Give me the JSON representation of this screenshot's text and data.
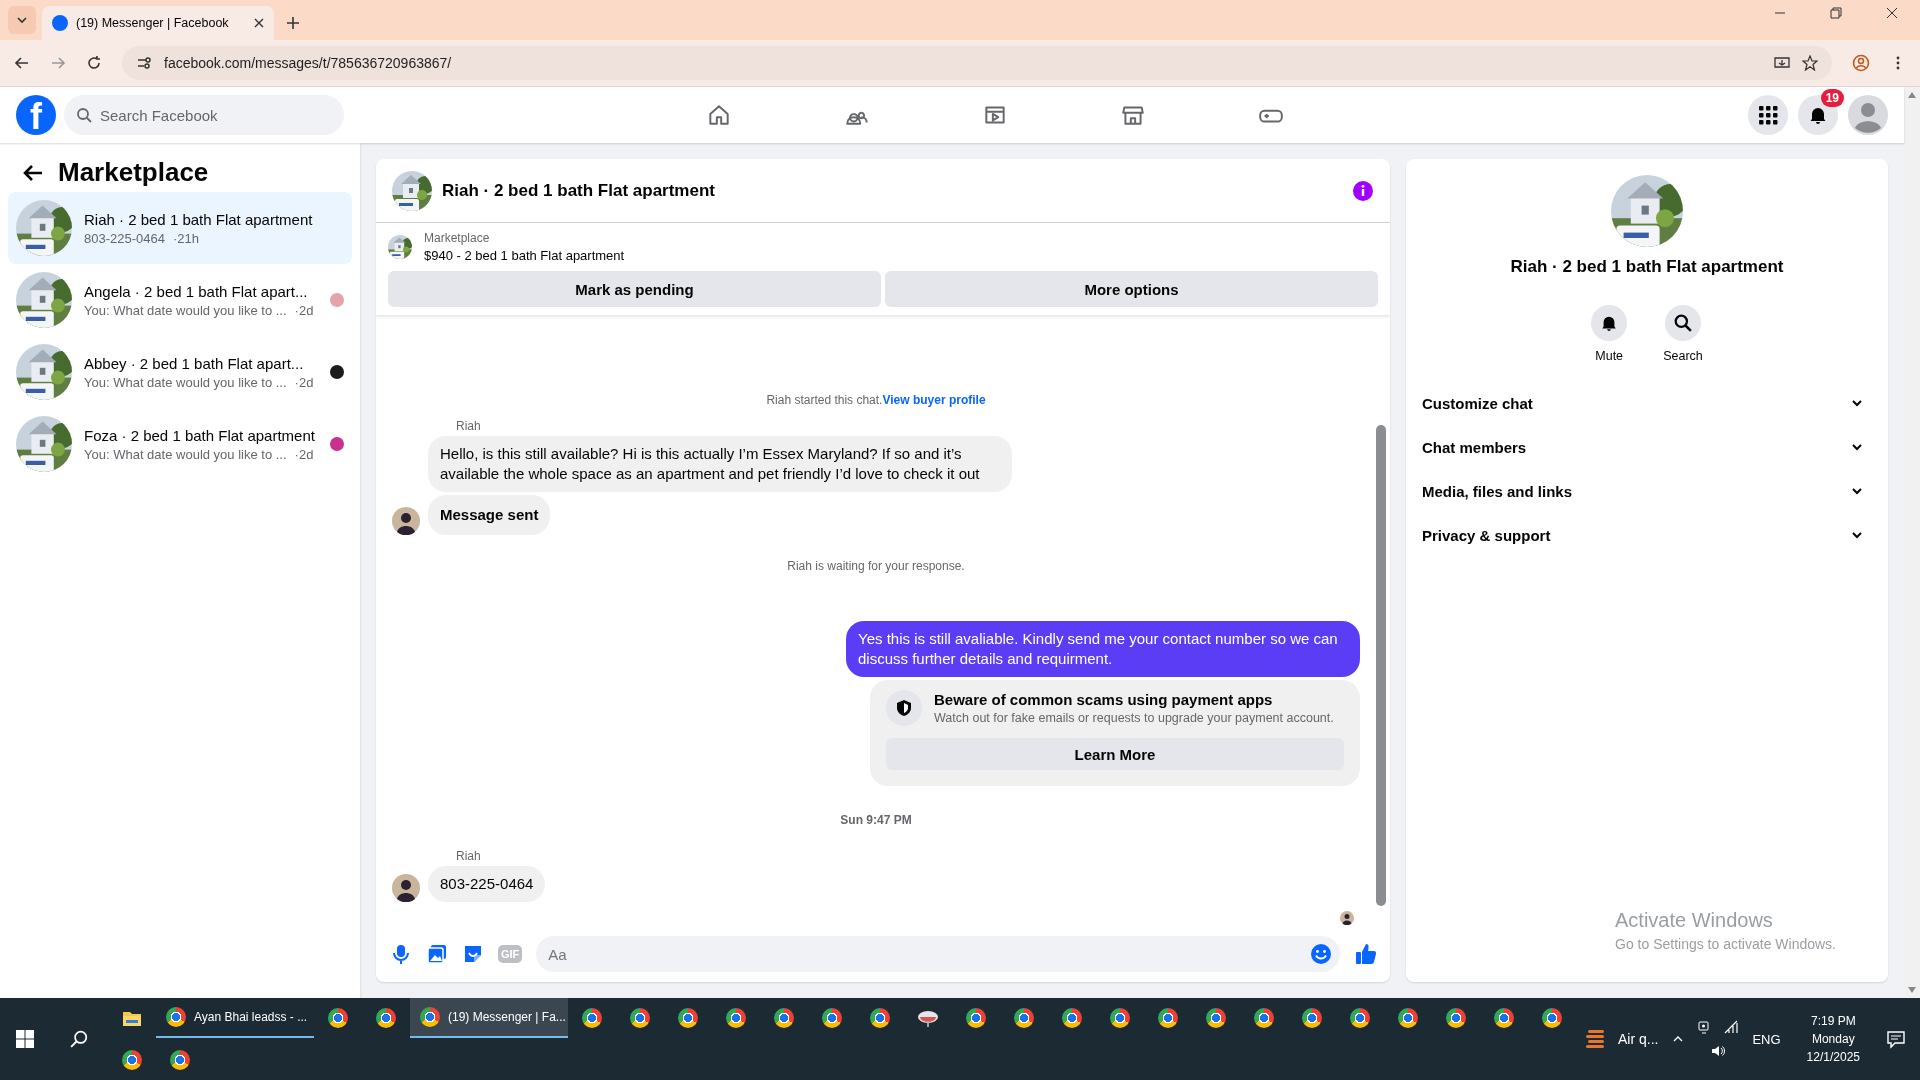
{
  "browser": {
    "tabs": [
      {
        "title": "(19) Messenger | Facebook",
        "selected": true
      }
    ],
    "url": "facebook.com/messages/t/785636720963867/"
  },
  "nav": {
    "logo": "f",
    "search_placeholder": "Search Facebook",
    "items": [
      {
        "kind": "home"
      },
      {
        "kind": "friends"
      },
      {
        "kind": "video"
      },
      {
        "kind": "marketplace"
      },
      {
        "kind": "gaming"
      }
    ],
    "notification_count": "19"
  },
  "sidebar": {
    "title": "Marketplace",
    "conversations": [
      {
        "name": "Riah · 2 bed 1 bath Flat apartment",
        "preview": "803-225-0464",
        "time": "·21h",
        "selected": true
      },
      {
        "name": "Angela · 2 bed 1 bath Flat apart...",
        "preview": "You: What date would you like to ...",
        "time": "·2d",
        "selected": false,
        "color": "#e3a3a8"
      },
      {
        "name": "Abbey · 2 bed 1 bath Flat apart...",
        "preview": "You: What date would you like to ...",
        "time": "·2d",
        "selected": false,
        "color": "#1c1c1c"
      },
      {
        "name": "Foza · 2 bed 1 bath Flat apartment",
        "preview": "You: What date would you like to ...",
        "time": "·2d",
        "selected": false,
        "color": "#c8328e"
      }
    ]
  },
  "chat": {
    "title": "Riah · 2 bed 1 bath Flat apartment",
    "listing": {
      "label": "Marketplace",
      "title": "$940 - 2 bed 1 bath Flat apartment"
    },
    "buttons": [
      "Mark as pending",
      "More options"
    ],
    "messages": [
      {
        "kind": "notice",
        "text": "Riah started this chat.",
        "link": "View buyer profile"
      },
      {
        "kind": "sender",
        "text": "Riah"
      },
      {
        "kind": "incoming",
        "text": "Hello, is this still available? Hi is this actually I’m Essex Maryland? If so and it’s available the whole space as an apartment and pet friendly I’d love to check it out",
        "avatar": false
      },
      {
        "kind": "status",
        "text": "Message sent",
        "avatar": true
      },
      {
        "kind": "notice",
        "text": "Riah is waiting for your response."
      },
      {
        "kind": "outgoing",
        "text": "Yes this is still avaliable. Kindly send me your contact number so we can discuss further details and requirment."
      },
      {
        "kind": "warning",
        "title": "Beware of common scams using payment apps",
        "text": "Watch out for fake emails or requests to upgrade your payment account.",
        "button": "Learn More"
      },
      {
        "kind": "timestamp",
        "text": "Sun 9:47 PM"
      },
      {
        "kind": "sender",
        "text": "Riah"
      },
      {
        "kind": "incoming",
        "text": "803-225-0464",
        "avatar": true
      },
      {
        "kind": "seen"
      }
    ],
    "composer": {
      "gif": "GIF",
      "placeholder": "Aa"
    }
  },
  "details": {
    "title": "Riah · 2 bed 1 bath Flat apartment",
    "actions": [
      {
        "kind": "mute",
        "label": "Mute"
      },
      {
        "kind": "search",
        "label": "Search"
      }
    ],
    "sections": [
      {
        "label": "Customize chat",
        "expanded": false
      },
      {
        "label": "Chat members",
        "expanded": false
      },
      {
        "label": "Media, files and links",
        "expanded": false
      },
      {
        "label": "Privacy & support",
        "expanded": false
      }
    ]
  },
  "activation": {
    "title": "Activate Windows",
    "text": "Go to Settings to activate Windows."
  },
  "taskbar": {
    "row_1": [
      {
        "kind": "folder"
      },
      {
        "kind": "browser",
        "label": "Ayan Bhai leadss - ...",
        "selected": false
      },
      {
        "kind": "browser"
      },
      {
        "kind": "browser"
      },
      {
        "kind": "browser",
        "label": "(19) Messenger | Fa...",
        "selected": true
      },
      {
        "kind": "browser"
      },
      {
        "kind": "browser"
      },
      {
        "kind": "browser"
      },
      {
        "kind": "browser"
      },
      {
        "kind": "browser"
      },
      {
        "kind": "browser"
      },
      {
        "kind": "browser"
      },
      {
        "kind": "dish"
      },
      {
        "kind": "browser"
      },
      {
        "kind": "browser"
      },
      {
        "kind": "browser"
      },
      {
        "kind": "browser"
      },
      {
        "kind": "browser"
      },
      {
        "kind": "browser"
      },
      {
        "kind": "browser"
      },
      {
        "kind": "browser"
      },
      {
        "kind": "browser"
      },
      {
        "kind": "browser"
      },
      {
        "kind": "browser"
      },
      {
        "kind": "browser"
      },
      {
        "kind": "browser"
      }
    ],
    "row_2": [
      {
        "kind": "browser"
      },
      {
        "kind": "browser"
      }
    ],
    "weather": "Air q...",
    "language": "ENG",
    "time": "7:19 PM",
    "day": "Monday",
    "date": "12/1/2025"
  }
}
